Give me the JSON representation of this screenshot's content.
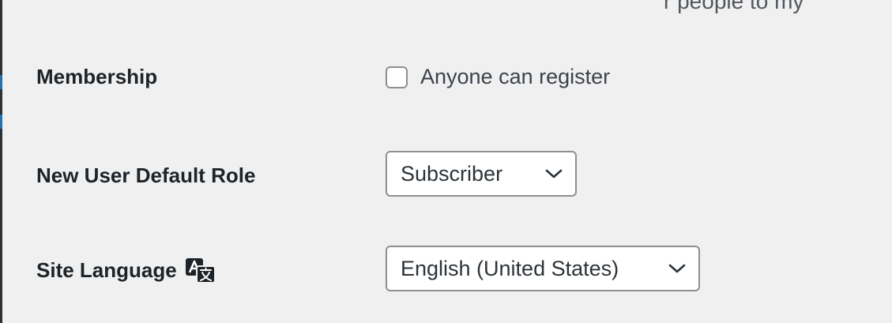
{
  "header": {
    "partial_text": "r people to my"
  },
  "settings": {
    "membership": {
      "label": "Membership",
      "checkbox_label": "Anyone can register",
      "checked": false
    },
    "default_role": {
      "label": "New User Default Role",
      "selected": "Subscriber"
    },
    "site_language": {
      "label": "Site Language",
      "icon": "translation-icon",
      "selected": "English (United States)"
    }
  },
  "colors": {
    "background": "#f0f0f1",
    "text": "#1d2327",
    "border": "#8c8f94",
    "accent": "#2271b1"
  }
}
